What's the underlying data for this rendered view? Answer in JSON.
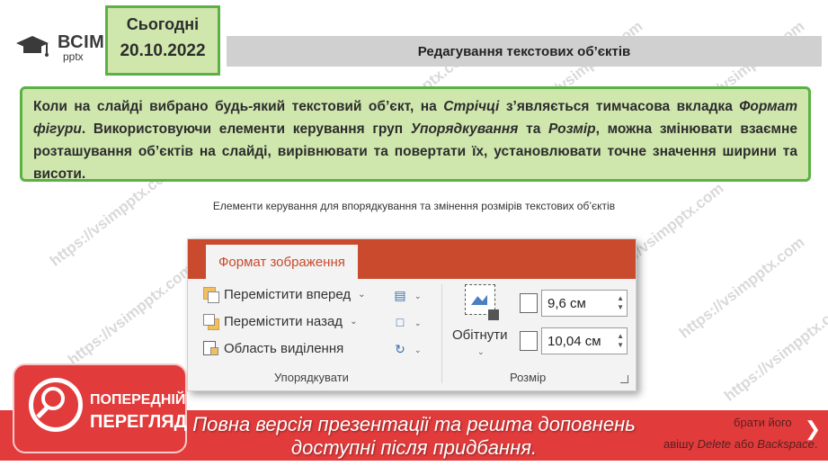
{
  "logo": {
    "text": "ВСІМ",
    "sub": "pptx"
  },
  "date": {
    "label": "Сьогодні",
    "value": "20.10.2022"
  },
  "header": {
    "title": "Редагування текстових об’єктів"
  },
  "main": {
    "p1": "Коли на слайді вибрано будь-який текстовий об’єкт, на ",
    "i1": "Стрічці",
    "p2": " з’являється тимчасова вкладка ",
    "i2": "Формат фігури",
    "p3": ". Використовуючи елементи керування груп ",
    "i3": "Упорядкування",
    "p4": " та ",
    "i4": "Розмір",
    "p5": ", можна змінювати взаємне розташування об’єктів на слайді, вирівнювати та повертати їх, установлювати точне значення ширини та висоти."
  },
  "caption": "Елементи керування для впорядкування та змінення розмірів текстових об’єктів",
  "ribbon": {
    "tab_label": "Формат зображення",
    "bring_forward": "Перемістити вперед",
    "send_backward": "Перемістити назад",
    "selection_pane": "Область виділення",
    "group_arrange": "Упорядкувати",
    "crop": "Обітнути",
    "height_value": "9,6 см",
    "width_value": "10,04 см",
    "group_size": "Розмір"
  },
  "banner": {
    "line1": "Повна версія презентації та решта доповнень",
    "line2": "доступні після придбання.",
    "ghost1": "брати його",
    "ghost2a": "авішу ",
    "ghost2b": "Delete",
    "ghost2c": " або ",
    "ghost2d": "Backspace",
    "ghost2e": "."
  },
  "preview": {
    "line1": "ПОПЕРЕДНІЙ",
    "line2": "ПЕРЕГЛЯД"
  },
  "watermark": "https://vsimpptx.com",
  "colors": {
    "green_fill": "#cfe6ad",
    "green_border": "#5bb146",
    "ribbon_accent": "#c94a2c",
    "banner_red": "#e23b3b"
  }
}
